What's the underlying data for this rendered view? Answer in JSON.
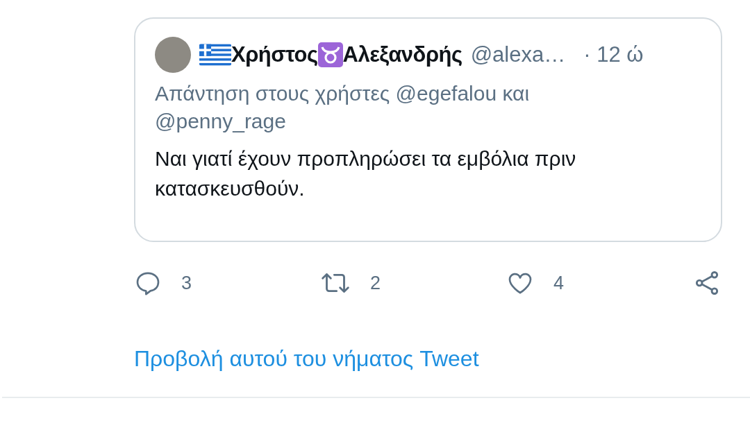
{
  "quoted_tweet": {
    "author": {
      "name_first": "Χρήστος",
      "name_last": "Αλεξανδρής",
      "handle": "@alexa…",
      "time": "· 12 ώ"
    },
    "reply_context": "Απάντηση στους χρήστες @egefalou και @penny_rage",
    "text": "Ναι γιατί έχουν προπληρώσει τα εμβόλια πριν κατασκευσθούν."
  },
  "actions": [
    {
      "kind": "reply",
      "count": "3"
    },
    {
      "kind": "retweet",
      "count": "2"
    },
    {
      "kind": "like",
      "count": "4"
    },
    {
      "kind": "share"
    }
  ],
  "thread_link": "Προβολή αυτού του νήματος Tweet"
}
